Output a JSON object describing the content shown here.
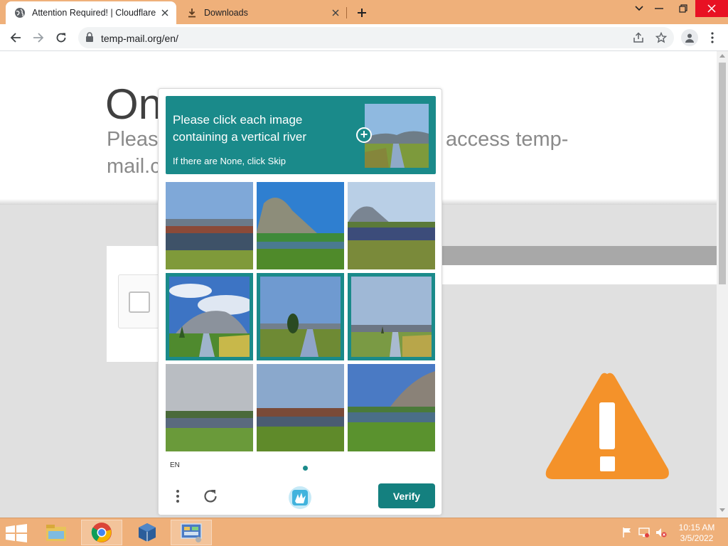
{
  "browser": {
    "tabs": [
      {
        "title": "Attention Required! | Cloudflare",
        "favicon": "globe-icon",
        "active": true
      },
      {
        "title": "Downloads",
        "favicon": "download-icon",
        "active": false
      }
    ],
    "url": "temp-mail.org/en/",
    "theme_color": "#efb07a"
  },
  "page": {
    "heading": "On",
    "subtitle_line1_left": "Please",
    "subtitle_line1_right": "access temp-",
    "subtitle_line2": "mail.c"
  },
  "captcha": {
    "prompt": "Please click each image containing a vertical river",
    "hint": "If there are None, click Skip",
    "language": "EN",
    "verify_label": "Verify",
    "accent_color": "#1a8a8a",
    "tiles": [
      {
        "scene": "lake-horizontal",
        "selected": false
      },
      {
        "scene": "mountain-lake",
        "selected": false
      },
      {
        "scene": "mountain-lake",
        "selected": false
      },
      {
        "scene": "mountain-vertical-river",
        "selected": true
      },
      {
        "scene": "tree-vertical-river",
        "selected": true
      },
      {
        "scene": "tree-vertical-river",
        "selected": true
      },
      {
        "scene": "lake-horizontal",
        "selected": false
      },
      {
        "scene": "lake-horizontal",
        "selected": false
      },
      {
        "scene": "mountain-lake",
        "selected": false
      }
    ]
  },
  "taskbar": {
    "time": "10:15 AM",
    "date": "3/5/2022",
    "apps": [
      "file-explorer-icon",
      "chrome-icon",
      "virtualbox-icon",
      "control-panel-icon"
    ]
  }
}
